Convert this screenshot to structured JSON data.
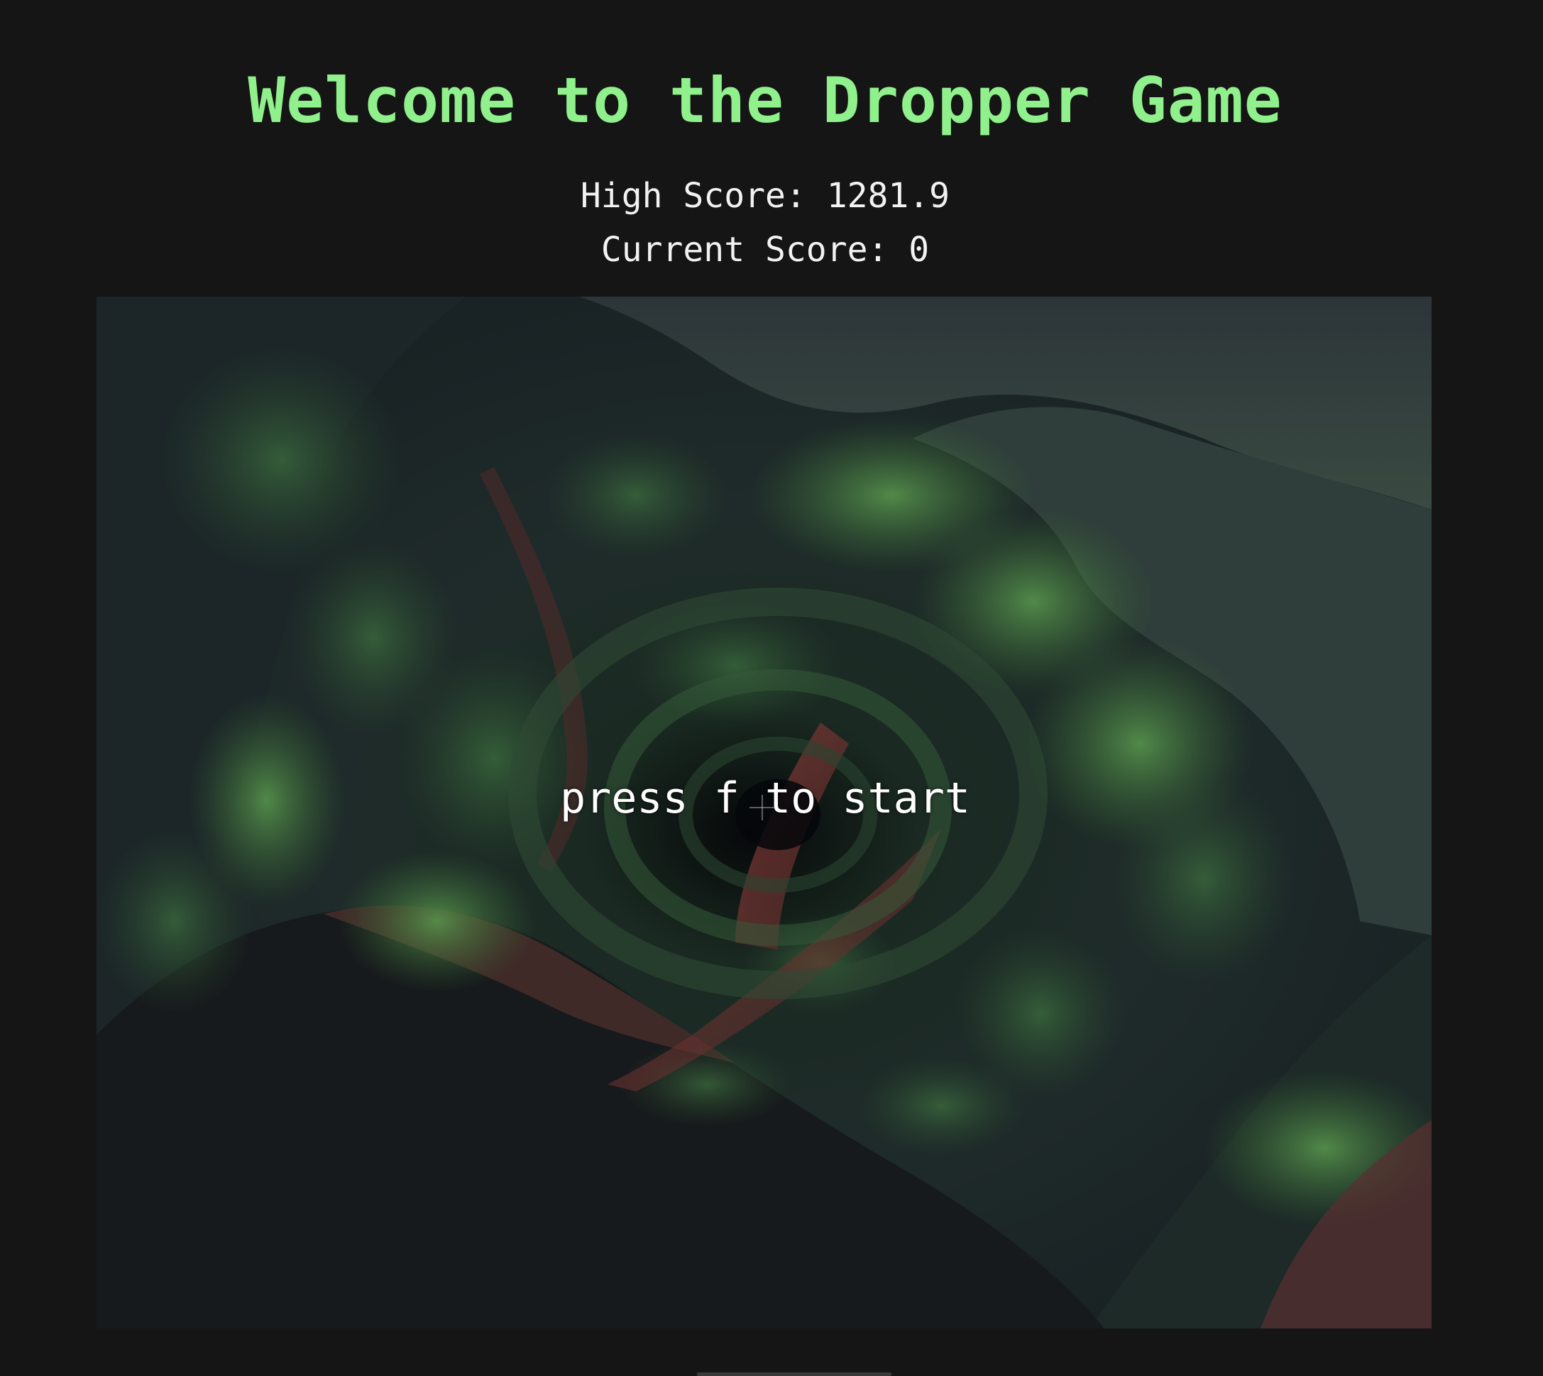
{
  "header": {
    "title": "Welcome to the Dropper Game"
  },
  "scores": {
    "high_score_text": "High Score: 1281.9",
    "current_score_text": "Current Score: 0"
  },
  "game": {
    "start_prompt": "press f to start"
  },
  "colors": {
    "background": "#151515",
    "title": "#8ff08c",
    "text": "#f2f2f2",
    "moss": "#4f8a45",
    "rock": "#2a3336",
    "root": "#7a3a36"
  },
  "icons": {
    "crosshair": "crosshair-icon"
  }
}
